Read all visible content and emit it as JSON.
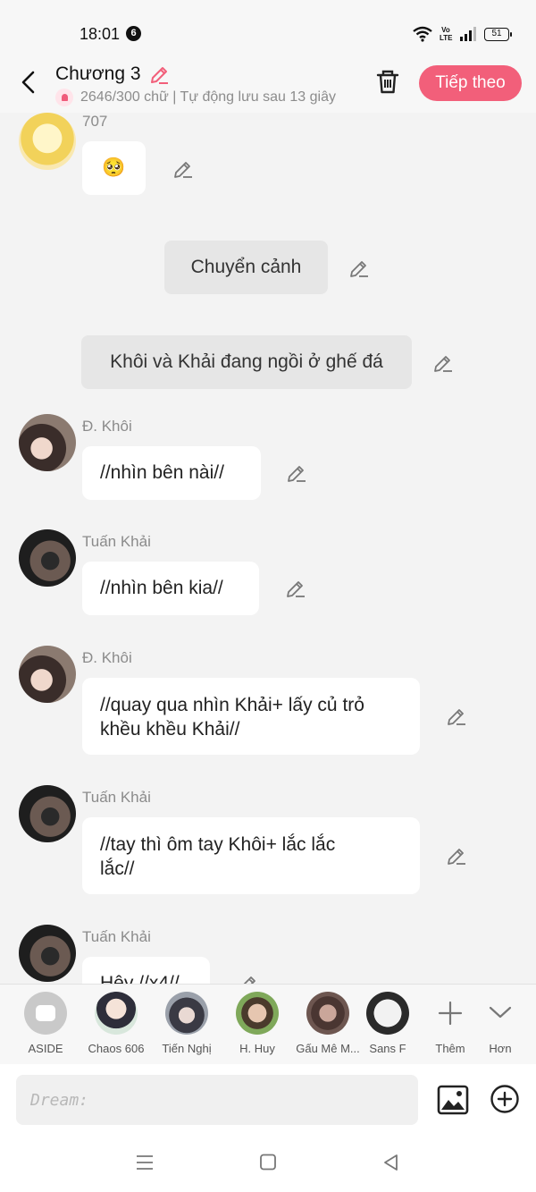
{
  "status_bar": {
    "time": "18:01",
    "notification_count": "6",
    "network_label": "Vo LTE",
    "battery_level": "51"
  },
  "header": {
    "title": "Chương 3",
    "save_info": "2646/300 chữ | Tự động lưu sau 13 giây",
    "next_label": "Tiếp theo",
    "accent_color": "#f25f7a"
  },
  "messages": {
    "m0": {
      "sender": "707",
      "text": "🥺"
    },
    "scene": {
      "text": "Chuyển cảnh"
    },
    "narration": {
      "text": "Khôi và Khải đang ngồi ở ghế đá"
    },
    "m1": {
      "sender": "Đ. Khôi",
      "text": "//nhìn bên nài//"
    },
    "m2": {
      "sender": "Tuấn Khải",
      "text": "//nhìn bên kia//"
    },
    "m3": {
      "sender": "Đ. Khôi",
      "line1": "//quay qua nhìn Khải+ lấy củ trỏ",
      "line2": "khều khều Khải//"
    },
    "m4": {
      "sender": "Tuấn Khải",
      "line1": "//tay thì ôm tay Khôi+ lắc lắc",
      "line2": "lắc//"
    },
    "m5": {
      "sender": "Tuấn Khải",
      "text": "Hêy //x4//"
    }
  },
  "cast_bar": {
    "items": [
      {
        "label": "ASIDE"
      },
      {
        "label": "Chaos 606"
      },
      {
        "label": "Tiến Nghị"
      },
      {
        "label": "H. Huy"
      },
      {
        "label": "Gấu Mê M..."
      },
      {
        "label": "Sans F"
      }
    ],
    "add_label": "Thêm",
    "more_label": "Hơn"
  },
  "composer": {
    "placeholder": "Dream:"
  }
}
